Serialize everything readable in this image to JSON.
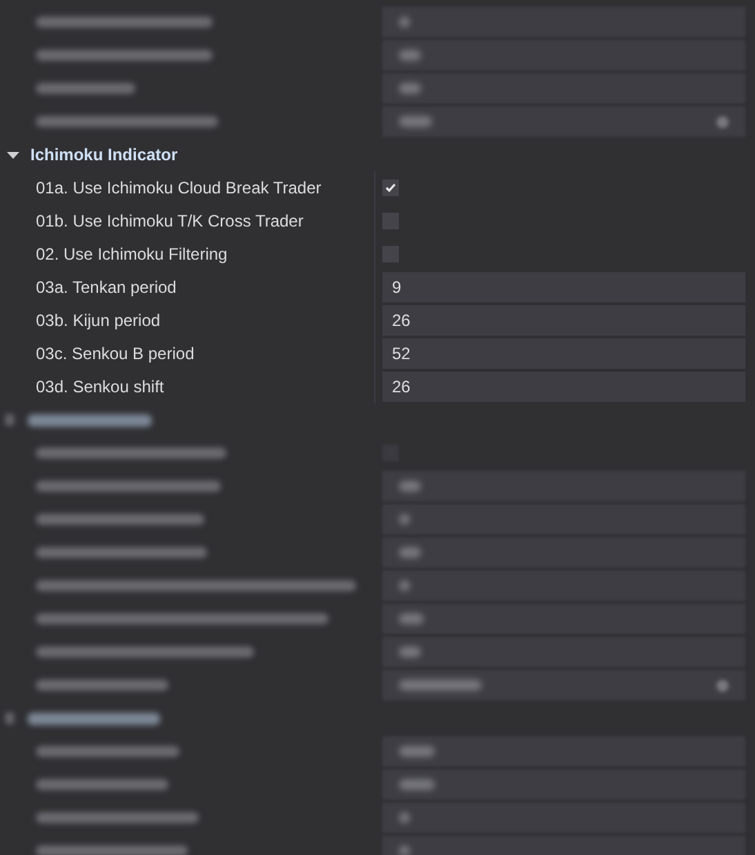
{
  "section": {
    "title": "Ichimoku Indicator",
    "expanded": true,
    "rows": [
      {
        "kind": "checkbox",
        "label": "01a. Use Ichimoku Cloud Break Trader",
        "checked": true
      },
      {
        "kind": "checkbox",
        "label": "01b. Use Ichimoku T/K Cross Trader",
        "checked": false
      },
      {
        "kind": "checkbox",
        "label": "02. Use Ichimoku Filtering",
        "checked": false
      },
      {
        "kind": "number",
        "label": "03a. Tenkan period",
        "value": "9"
      },
      {
        "kind": "number",
        "label": "03b. Kijun period",
        "value": "26"
      },
      {
        "kind": "number",
        "label": "03c. Senkou B period",
        "value": "52"
      },
      {
        "kind": "number",
        "label": "03d. Senkou shift",
        "value": "26"
      }
    ]
  }
}
